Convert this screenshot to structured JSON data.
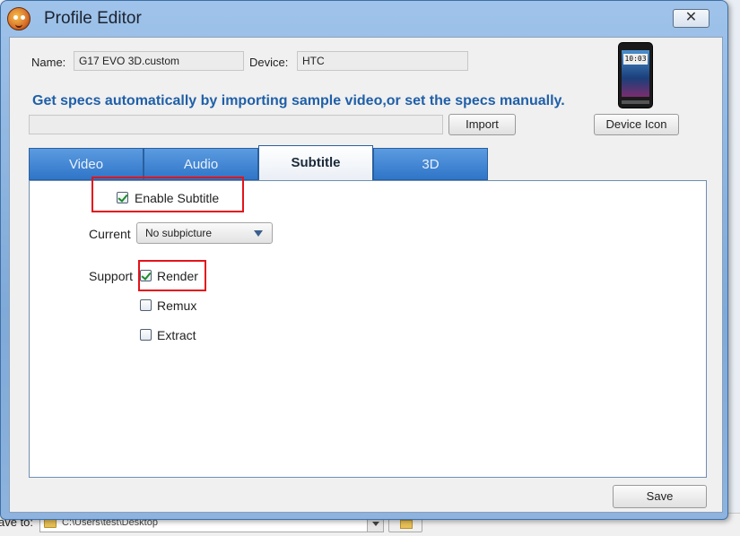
{
  "background": {
    "save_to_label": "ave to:",
    "save_path": "C:\\Users\\test\\Desktop"
  },
  "window": {
    "title": "Profile Editor",
    "close_label": "✕"
  },
  "header": {
    "name_label": "Name:",
    "name_value": "G17 EVO 3D.custom",
    "device_label": "Device:",
    "device_value": "HTC",
    "phone_clock": "10:03",
    "headline": "Get specs automatically by importing sample video,or set the specs manually.",
    "import_value": "",
    "import_button": "Import",
    "device_icon_button": "Device Icon"
  },
  "tabs": [
    {
      "label": "Video",
      "active": false
    },
    {
      "label": "Audio",
      "active": false
    },
    {
      "label": "Subtitle",
      "active": true
    },
    {
      "label": "3D",
      "active": false
    }
  ],
  "subtitle_panel": {
    "enable_label": "Enable Subtitle",
    "enable_checked": true,
    "current_label": "Current",
    "current_value": "No subpicture",
    "support_label": "Support",
    "options": [
      {
        "label": "Render",
        "checked": true
      },
      {
        "label": "Remux",
        "checked": false
      },
      {
        "label": "Extract",
        "checked": false
      }
    ]
  },
  "footer": {
    "save_button": "Save"
  },
  "colors": {
    "accent_headline": "#1f5fa8",
    "tab_blue": "#2f75c8",
    "highlight_red": "#e3141b"
  }
}
